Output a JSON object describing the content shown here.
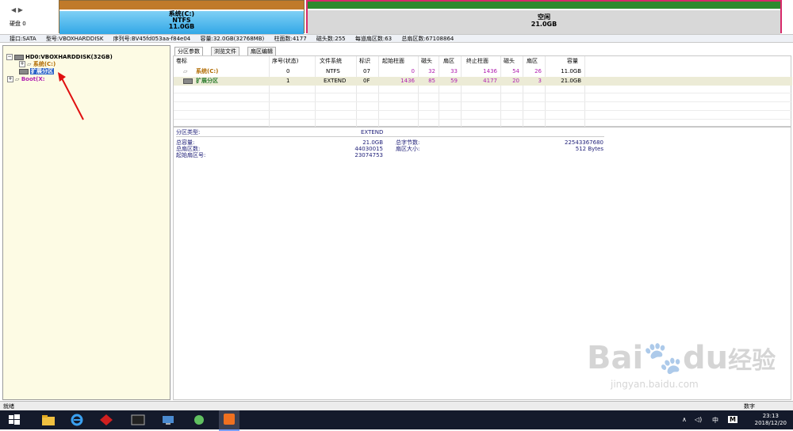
{
  "disk_map": {
    "disk_label": "硬盘 0",
    "partition_c": {
      "name": "系统(C:)",
      "fs": "NTFS",
      "size": "11.0GB"
    },
    "partition_free": {
      "name": "空闲",
      "size": "21.0GB"
    }
  },
  "info": {
    "interface": "接口:SATA",
    "model": "型号:VBOXHARDDISK",
    "serial": "序列号:BV45fd053aa-f84e04",
    "capacity": "容量:32.0GB(32768MB)",
    "cylinders": "柱面数:4177",
    "heads": "磁头数:255",
    "sectors_per_track": "每道扇区数:63",
    "total_sectors": "总扇区数:67108864"
  },
  "tree": {
    "disk": "HD0:VBOXHARDDISK(32GB)",
    "items": [
      {
        "label": "系统(C:)"
      },
      {
        "label": "扩展分区"
      },
      {
        "label": "Boot(X:"
      }
    ]
  },
  "tabs": [
    {
      "label": "分区参数"
    },
    {
      "label": "浏览文件"
    },
    {
      "label": "扇区编辑"
    }
  ],
  "table": {
    "headers": [
      "卷标",
      "序号(状态)",
      "文件系统",
      "标识",
      "起始柱面",
      "磁头",
      "扇区",
      "终止柱面",
      "磁头",
      "扇区",
      "容量"
    ],
    "rows": [
      {
        "label": "系统(C:)",
        "seq": "0",
        "fs": "NTFS",
        "id": "07",
        "start_cyl": "0",
        "start_head": "32",
        "start_sec": "33",
        "end_cyl": "1436",
        "end_head": "54",
        "end_sec": "26",
        "size": "11.0GB"
      },
      {
        "label": "扩展分区",
        "seq": "1",
        "fs": "EXTEND",
        "id": "0F",
        "start_cyl": "1436",
        "start_head": "85",
        "start_sec": "59",
        "end_cyl": "4177",
        "end_head": "20",
        "end_sec": "3",
        "size": "21.0GB"
      }
    ]
  },
  "details": {
    "type_label": "分区类型:",
    "type_value": "EXTEND",
    "total_cap_label": "总容量:",
    "total_cap_value": "21.0GB",
    "total_bytes_label": "总字节数:",
    "total_bytes_value": "22543367680",
    "total_sectors_label": "总扇区数:",
    "total_sectors_value": "44030015",
    "sector_size_label": "扇区大小:",
    "sector_size_value": "512 Bytes",
    "start_sector_label": "起始扇区号:",
    "start_sector_value": "23074753"
  },
  "watermark": {
    "brand": "Bai",
    "brand2": "du",
    "cn": "经验",
    "url": "jingyan.baidu.com"
  },
  "status": {
    "left": "就绪",
    "right": "数字"
  },
  "taskbar": {
    "ime": "中",
    "ime2": "M",
    "time": "23:13",
    "date": "2018/12/20"
  },
  "colors": {
    "accent_orange": "#c07a2a",
    "free_border": "#d82a6b",
    "taskbar": "#141a2b"
  }
}
